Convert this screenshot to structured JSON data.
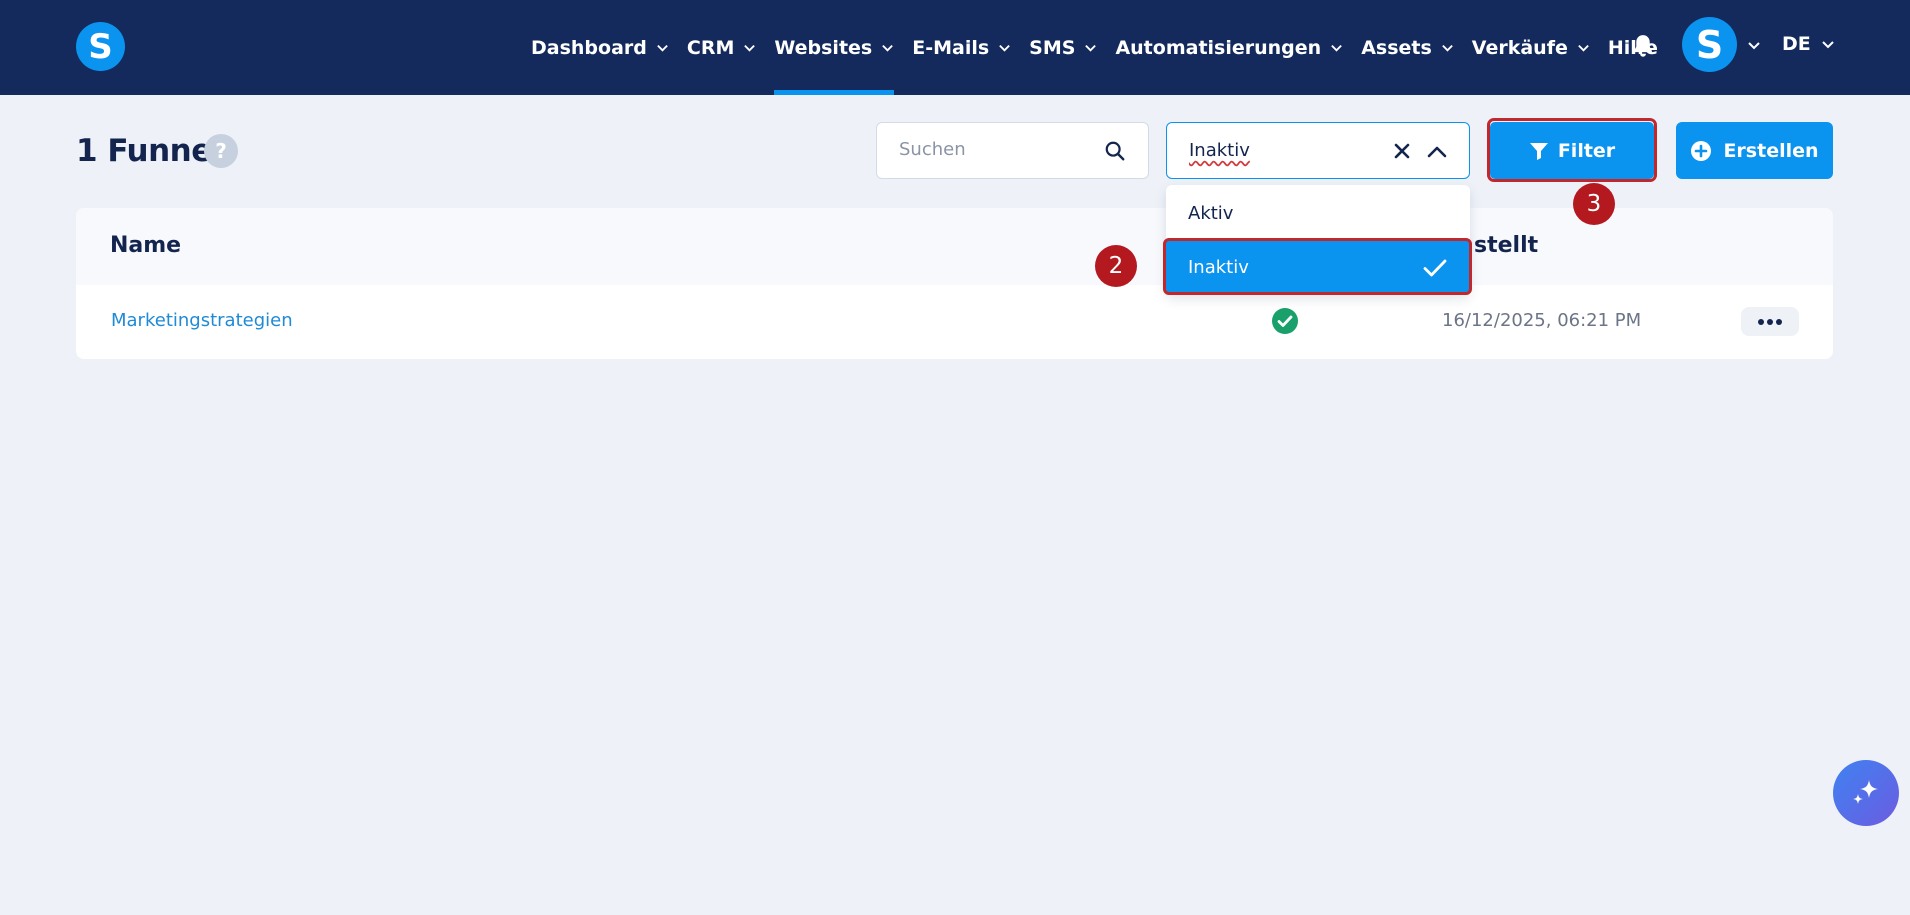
{
  "brand": {
    "logo_letter": "S",
    "accent": "#0b93f0",
    "navbar_bg": "#142a5c"
  },
  "nav": {
    "items": [
      {
        "label": "Dashboard",
        "has_dropdown": true
      },
      {
        "label": "CRM",
        "has_dropdown": true
      },
      {
        "label": "Websites",
        "has_dropdown": true,
        "active": true
      },
      {
        "label": "E-Mails",
        "has_dropdown": true
      },
      {
        "label": "SMS",
        "has_dropdown": true
      },
      {
        "label": "Automatisierungen",
        "has_dropdown": true
      },
      {
        "label": "Assets",
        "has_dropdown": true
      },
      {
        "label": "Verkäufe",
        "has_dropdown": true
      },
      {
        "label": "Hilfe",
        "has_dropdown": false
      }
    ],
    "bell_icon": "bell-icon",
    "avatar_letter": "S",
    "language": "DE"
  },
  "header": {
    "title": "1 Funnel",
    "help_symbol": "?"
  },
  "search": {
    "placeholder": "Suchen",
    "value": ""
  },
  "status_filter": {
    "selected": "Inaktiv",
    "options": [
      "Aktiv",
      "Inaktiv"
    ],
    "open": true
  },
  "buttons": {
    "filter_label": "Filter",
    "create_label": "Erstellen"
  },
  "annotations": {
    "step_2": "2",
    "step_3": "3",
    "highlight_color": "#c0282d"
  },
  "table": {
    "columns": {
      "name": "Name",
      "created": "stellt"
    },
    "rows": [
      {
        "name": "Marketingstrategien",
        "status": "active",
        "created": "16/12/2025, 06:21 PM"
      }
    ]
  }
}
